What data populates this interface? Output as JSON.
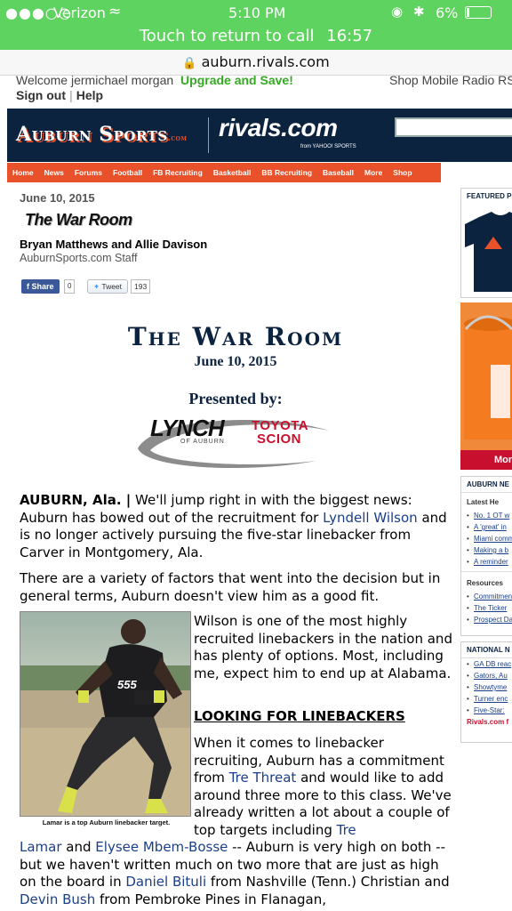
{
  "status": {
    "carrier": "Verizon",
    "time": "5:10 PM",
    "battery": "6%"
  },
  "call_banner": {
    "label": "Touch to return to call",
    "duration": "16:57"
  },
  "url": "auburn.rivals.com",
  "utility": {
    "welcome": "Welcome",
    "user": "jermichael morgan",
    "upgrade": "Upgrade and Save!",
    "sign_out": "Sign out",
    "help": "Help",
    "links": "Shop Mobile Radio RS"
  },
  "masthead": {
    "site": "Auburn Sports",
    "site_suffix": ".com",
    "network": "rivals.com",
    "network_sub": "from YAHOO! SPORTS"
  },
  "nav": [
    "Home",
    "News",
    "Forums",
    "Football",
    "FB Recruiting",
    "Basketball",
    "BB Recruiting",
    "Baseball",
    "More",
    "Shop"
  ],
  "article": {
    "date": "June 10, 2015",
    "column": "The War Room",
    "authors": "Bryan Matthews and Allie Davison",
    "staff": "AuburnSports.com Staff",
    "share_label": "Share",
    "share_count": "0",
    "tweet_label": "Tweet",
    "tweet_count": "193",
    "banner_title": "The War Room",
    "banner_date": "June 10, 2015",
    "presented_by": "Presented by:",
    "sponsor_lynch": "LYNCH",
    "sponsor_of": "OF AUBURN",
    "sponsor_toyota": "TOYOTA",
    "sponsor_scion": "SCION",
    "p1_dateline": "AUBURN, Ala. |",
    "p1_a": " We'll jump right in with the biggest news: Auburn has bowed out of the recruitment for ",
    "p1_link": "Lyndell Wilson",
    "p1_b": " and is no longer actively pursuing the five-star linebacker from Carver in Montgomery, Ala.",
    "p2": "There are a variety of factors that went into the decision but in general terms, Auburn doesn't view him as a good fit.",
    "photo_caption": "Lamar is a top Auburn linebacker target.",
    "photo_jersey": "555",
    "p3": "Wilson is one of the most highly recruited linebackers in the nation and has plenty of options. Most, including me, expect him to end up at Alabama.",
    "heading": "LOOKING FOR LINEBACKERS",
    "p4_a": "When it comes to linebacker recruiting, Auburn has a commitment from ",
    "p4_link1": "Tre Threat",
    "p4_b": " and would like to add around three more to this class. We've already written a lot about a couple of top targets including ",
    "p4_link2": "Tre",
    "p5_link2b": "Lamar",
    "p5_a": " and ",
    "p5_link3": "Elysee Mbem-Bosse",
    "p5_b": " -- Auburn is very high on both -- but we haven't written much on two more that are just as high on the board in ",
    "p5_link4": "Daniel Bituli",
    "p5_c": " from Nashville (Tenn.) ",
    "p5_d": "Christian and ",
    "p5_link5": "Devin Bush",
    "p5_e": " from Pembroke Pines in Flanagan,"
  },
  "rail": {
    "featured_head": "FEATURED P",
    "ad_more": "Mor",
    "news_head": "AUBURN NE",
    "latest_head": "Latest He",
    "latest_items": [
      "No. 1 OT w",
      "A 'great' in",
      "Miami comm",
      "Making a b",
      "A reminder"
    ],
    "resources_head": "Resources",
    "resources_items": [
      "Commitmen",
      "The Ticker",
      "Prospect Da"
    ],
    "national_head": "NATIONAL N",
    "national_items": [
      "GA DB reac",
      "Gators, Au",
      "Showtyme",
      "Turner enc",
      "Five-Star:"
    ],
    "rivals_link": "Rivals.com f"
  }
}
